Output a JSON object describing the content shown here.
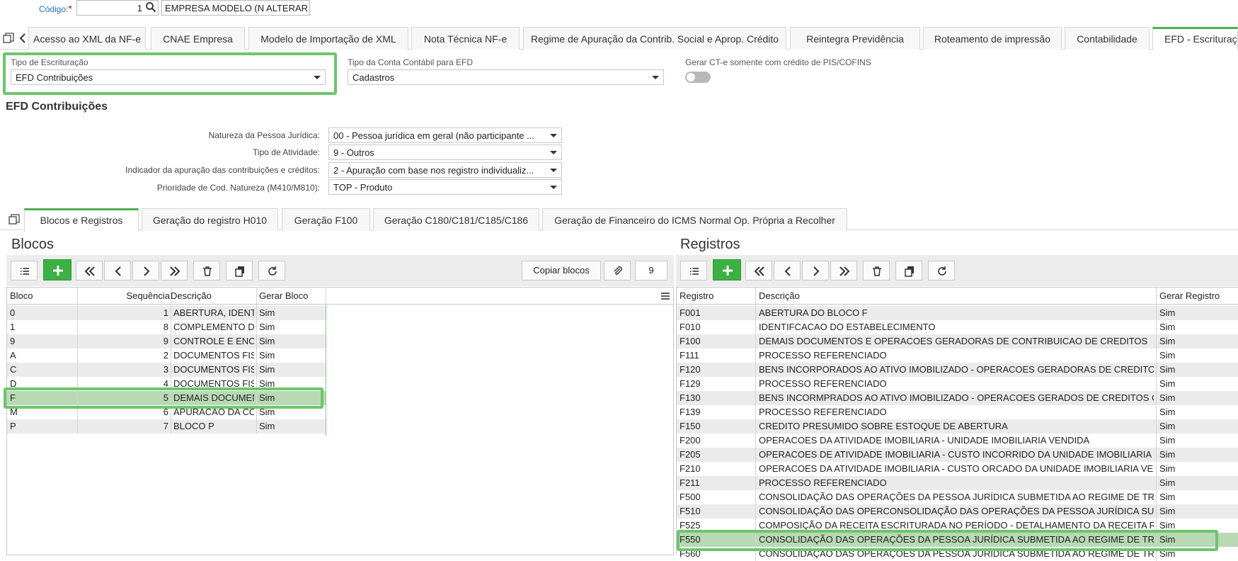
{
  "header": {
    "codigo_label": "Código:",
    "required_mark": "*",
    "codigo_value": "1",
    "empresa_value": "EMPRESA MODELO (N ALTERAR"
  },
  "main_tabs": [
    "Acesso ao XML da NF-e",
    "CNAE Empresa",
    "Modelo de Importação de XML",
    "Nota Técnica NF-e",
    "Regime de Apuração da Contrib. Social e Aprop. Crédito",
    "Reintegra Previdência",
    "Roteamento de impressão",
    "Contabilidade",
    "EFD - Escrituração"
  ],
  "form": {
    "tipo_escrituracao_label": "Tipo de Escrituração",
    "tipo_escrituracao_value": "EFD Contribuições",
    "tipo_conta_label": "Tipo da Conta Contábil para EFD",
    "tipo_conta_value": "Cadastros",
    "gerar_cte_label": "Gerar CT-e somente com crédito de PIS/COFINS",
    "gerar_cte_on": false
  },
  "efd": {
    "title": "EFD Contribuições",
    "fields": [
      {
        "label": "Natureza da Pessoa Jurídica:",
        "value": "00 - Pessoa jurídica em geral (não participante ..."
      },
      {
        "label": "Tipo de Atividade:",
        "value": "9 - Outros"
      },
      {
        "label": "Indicador da apuração das contribuições e créditos:",
        "value": "2 - Apuração com base nos registro individualiz..."
      },
      {
        "label": "Prioridade de Cod. Natureza (M410/M810):",
        "value": "TOP - Produto"
      }
    ]
  },
  "sub_tabs": [
    "Blocos e Registros",
    "Geração do registro H010",
    "Geração F100",
    "Geração C180/C181/C185/C186",
    "Geração de Financeiro do ICMS Normal Op. Própria a Recolher"
  ],
  "blocos": {
    "title": "Blocos",
    "copy_button": "Copiar blocos",
    "count": "9",
    "columns": [
      "Bloco",
      "Sequência",
      "Descrição",
      "Gerar Bloco"
    ],
    "rows": [
      {
        "bloco": "0",
        "seq": "1",
        "desc": "ABERTURA, IDENTI",
        "gerar": "Sim"
      },
      {
        "bloco": "1",
        "seq": "8",
        "desc": "COMPLEMENTO DA",
        "gerar": "Sim"
      },
      {
        "bloco": "9",
        "seq": "9",
        "desc": "CONTROLE E ENCE",
        "gerar": "Sim"
      },
      {
        "bloco": "A",
        "seq": "2",
        "desc": "DOCUMENTOS FISC",
        "gerar": "Sim"
      },
      {
        "bloco": "C",
        "seq": "3",
        "desc": "DOCUMENTOS FISC",
        "gerar": "Sim"
      },
      {
        "bloco": "D",
        "seq": "4",
        "desc": "DOCUMENTOS FISC",
        "gerar": "Sim"
      },
      {
        "bloco": "F",
        "seq": "5",
        "desc": "DEMAIS DOCUMEN",
        "gerar": "Sim"
      },
      {
        "bloco": "M",
        "seq": "6",
        "desc": "APURACAO DA CON",
        "gerar": "Sim"
      },
      {
        "bloco": "P",
        "seq": "7",
        "desc": "BLOCO P",
        "gerar": "Sim"
      }
    ]
  },
  "registros": {
    "title": "Registros",
    "columns": [
      "Registro",
      "Descrição",
      "Gerar Registro"
    ],
    "rows": [
      {
        "reg": "F001",
        "desc": "ABERTURA DO BLOCO F",
        "gerar": "Sim"
      },
      {
        "reg": "F010",
        "desc": "IDENTIFCACAO DO ESTABELECIMENTO",
        "gerar": "Sim"
      },
      {
        "reg": "F100",
        "desc": "DEMAIS DOCUMENTOS E OPERACOES GERADORAS DE CONTRIBUICAO DE CREDITOS",
        "gerar": "Sim"
      },
      {
        "reg": "F111",
        "desc": "PROCESSO REFERENCIADO",
        "gerar": "Sim"
      },
      {
        "reg": "F120",
        "desc": "BENS INCORPORADOS AO ATIVO IMOBILIZADO - OPERACOES GERADORAS DE CREDITOS",
        "gerar": "Sim"
      },
      {
        "reg": "F129",
        "desc": "PROCESSO REFERENCIADO",
        "gerar": "Sim"
      },
      {
        "reg": "F130",
        "desc": "BENS INCORMPRADOS AO ATIVO IMOBILIZADO - OPERACOES GERADOS DE CREDITOS C",
        "gerar": "Sim"
      },
      {
        "reg": "F139",
        "desc": "PROCESSO REFERENCIADO",
        "gerar": "Sim"
      },
      {
        "reg": "F150",
        "desc": "CREDITO PRESUMIDO SOBRE ESTOQUE DE ABERTURA",
        "gerar": "Sim"
      },
      {
        "reg": "F200",
        "desc": "OPERACOES DA ATIVIDADE IMOBILIARIA - UNIDADE IMOBILIARIA VENDIDA",
        "gerar": "Sim"
      },
      {
        "reg": "F205",
        "desc": "OPERACOES DE ATIVIDADE IMOBILIARIA - CUSTO INCORRIDO DA UNIDADE IMOBILIARIA",
        "gerar": "Sim"
      },
      {
        "reg": "F210",
        "desc": "OPERACOES DA ATIVIDADE IMOBILIARIA - CUSTO ORCADO DA UNIDADE IMOBILIARIA VEI",
        "gerar": "Sim"
      },
      {
        "reg": "F211",
        "desc": "PROCESSO REFERENCIADO",
        "gerar": "Sim"
      },
      {
        "reg": "F500",
        "desc": "CONSOLIDAÇÃO DAS OPERAÇÕES DA PESSOA JURÍDICA SUBMETIDA AO REGIME DE TR",
        "gerar": "Sim"
      },
      {
        "reg": "F510",
        "desc": "CONSOLIDAÇÃO DAS OPERCONSOLIDAÇÃO DAS OPERAÇÕES DA PESSOA JURÍDICA SU",
        "gerar": "Sim"
      },
      {
        "reg": "F525",
        "desc": "COMPOSIÇÃO DA RECEITA ESCRITURADA NO PERÍODO - DETALHAMENTO DA RECEITA R",
        "gerar": "Sim"
      },
      {
        "reg": "F550",
        "desc": "CONSOLIDAÇÃO DAS OPERAÇÕES DA PESSOA JURÍDICA SUBMETIDA AO REGIME DE TR",
        "gerar": "Sim"
      },
      {
        "reg": "F560",
        "desc": "CONSOLIDAÇÃO DAS OPERAÇÕES DA PESSOA JURÍDICA SUBMETIDA AO REGIME DE TR",
        "gerar": "Sim"
      }
    ]
  }
}
